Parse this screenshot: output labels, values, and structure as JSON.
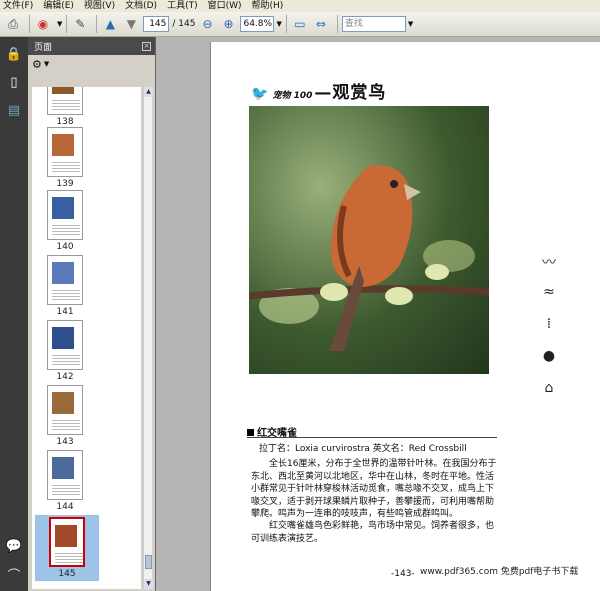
{
  "menu": [
    "文件(F)",
    "编辑(E)",
    "视图(V)",
    "文档(D)",
    "工具(T)",
    "窗口(W)",
    "帮助(H)"
  ],
  "toolbar": {
    "current_page": "145",
    "total_pages": "/ 145",
    "zoom": "64.8%",
    "search_placeholder": "查找"
  },
  "panel": {
    "title": "页面"
  },
  "thumbnails": [
    {
      "label": "138",
      "color": "#8b5a2b"
    },
    {
      "label": "139",
      "color": "#b7663a"
    },
    {
      "label": "140",
      "color": "#3a5fa0"
    },
    {
      "label": "141",
      "color": "#5a7ab8"
    },
    {
      "label": "142",
      "color": "#2e4f8c"
    },
    {
      "label": "143",
      "color": "#9a6a3a"
    },
    {
      "label": "144",
      "color": "#4a6a9a"
    },
    {
      "label": "145",
      "color": "#a04a2a"
    }
  ],
  "document": {
    "header_small": "宠物 100",
    "header_title": "—观赏鸟",
    "section_title": "红交嘴雀",
    "names": "拉丁名：Loxia curvirostra  英文名：Red Crossbill",
    "para1": "全长16厘米，分布于全世界的温带针叶林。在我国分布于东北、西北至黄河以北地区，华中在山林，冬时在平地。性活小群常见于针叶林穿梭林活动觅食，嘴总喙不交叉，成鸟上下喙交叉，适于剥开球果鳞片取种子，善攀援而，可利用嘴帮助攀爬。鸣声为一连串的吱吱声，有些鸣管成群鸣叫。",
    "para2": "红交嘴雀雄鸟色彩鲜艳，鸟市场中常见。饲养者很多，也可训练表演技艺。",
    "page_number": "-143-"
  },
  "watermark": "www.pdf365.com 免费pdf电子书下载"
}
